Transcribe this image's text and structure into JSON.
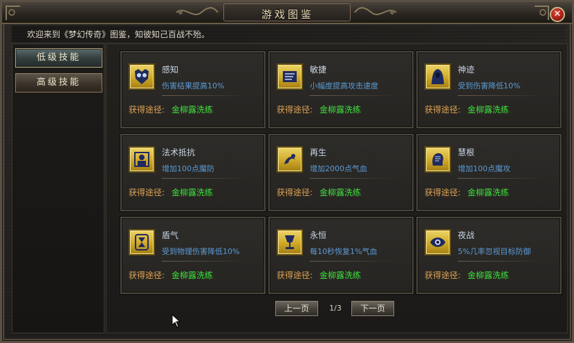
{
  "window": {
    "title": "游戏图鉴",
    "close_label": "✕"
  },
  "welcome_text": "欢迎来到《梦幻传奇》图鉴，知彼知己百战不殆。",
  "tabs": [
    {
      "label": "低级技能",
      "active": true
    },
    {
      "label": "高级技能",
      "active": false
    }
  ],
  "cards": [
    {
      "name": "感知",
      "desc": "伤害结果提高10%",
      "source_label": "获得途径:",
      "source_value": "金柳露洗练",
      "icon": "owl-mask-icon"
    },
    {
      "name": "敏捷",
      "desc": "小幅度提高攻击速度",
      "source_label": "获得途径:",
      "source_value": "金柳露洗练",
      "icon": "wind-scroll-icon"
    },
    {
      "name": "神迹",
      "desc": "受到伤害降低10%",
      "source_label": "获得途径:",
      "source_value": "金柳露洗练",
      "icon": "hooded-figure-icon"
    },
    {
      "name": "法术抵抗",
      "desc": "增加100点魔防",
      "source_label": "获得途径:",
      "source_value": "金柳露洗练",
      "icon": "magic-shield-icon"
    },
    {
      "name": "再生",
      "desc": "增加2000点气血",
      "source_label": "获得途径:",
      "source_value": "金柳露洗练",
      "icon": "regeneration-icon"
    },
    {
      "name": "慧根",
      "desc": "增加100点魔攻",
      "source_label": "获得途径:",
      "source_value": "金柳露洗练",
      "icon": "mind-head-icon"
    },
    {
      "name": "盾气",
      "desc": "受到物理伤害降低10%",
      "source_label": "获得途径:",
      "source_value": "金柳露洗练",
      "icon": "hourglass-shield-icon"
    },
    {
      "name": "永恒",
      "desc": "每10秒恢复1%气血",
      "source_label": "获得途径:",
      "source_value": "金柳露洗练",
      "icon": "goblet-icon"
    },
    {
      "name": "夜战",
      "desc": "5%几率忽视目标防御",
      "source_label": "获得途径:",
      "source_value": "金柳露洗练",
      "icon": "night-eye-icon"
    }
  ],
  "pager": {
    "prev_label": "上一页",
    "next_label": "下一页",
    "page": "1/3"
  },
  "colors": {
    "desc_blue": "#5a9bd6",
    "source_orange": "#e0a455",
    "source_green": "#3de23d",
    "icon_gold": "#d2ad2c"
  }
}
